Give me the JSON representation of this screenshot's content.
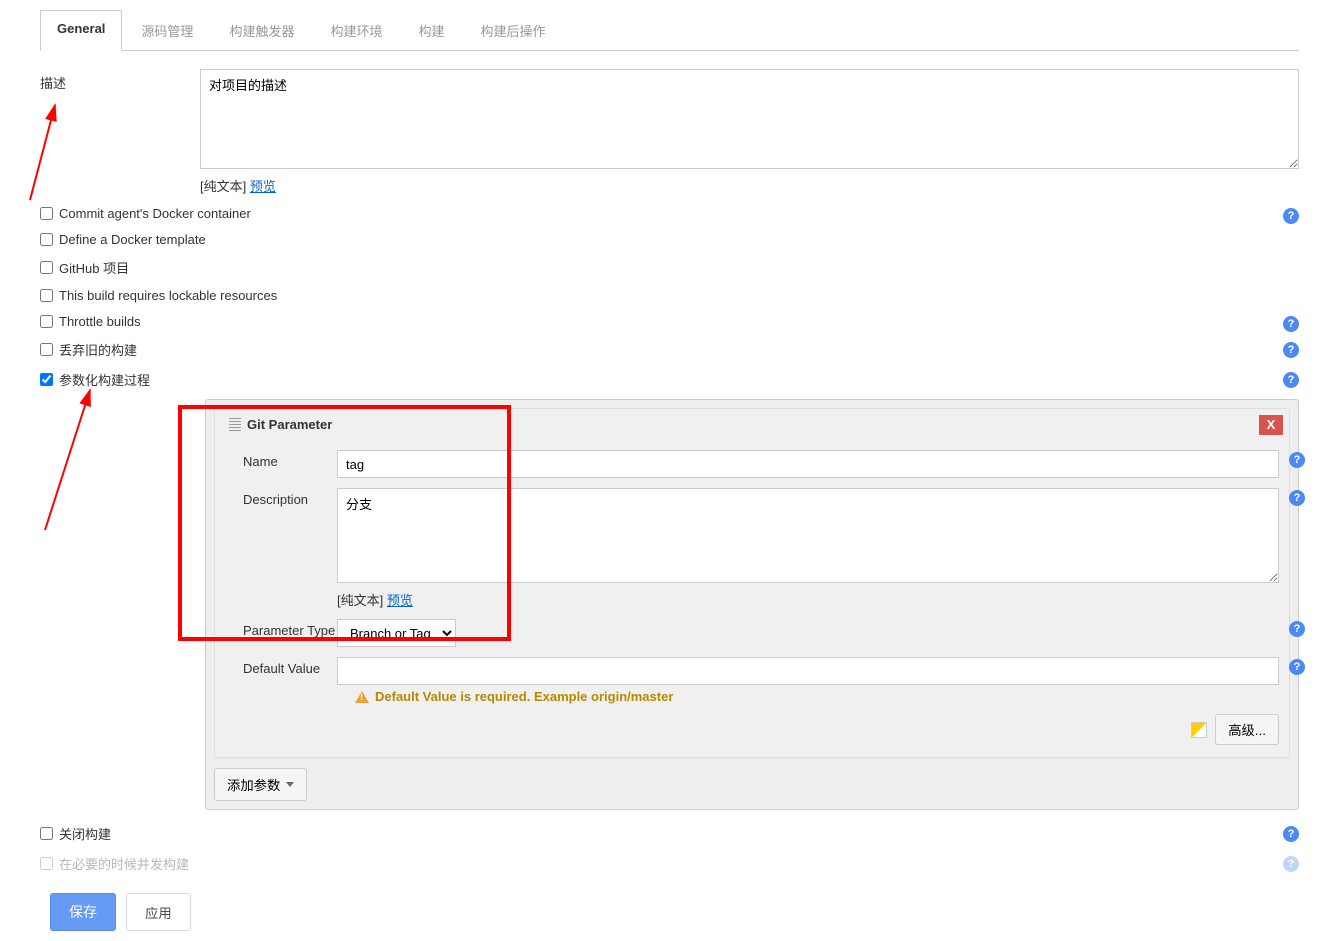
{
  "tabs": {
    "general": "General",
    "source": "源码管理",
    "triggers": "构建触发器",
    "env": "构建环境",
    "build": "构建",
    "post": "构建后操作"
  },
  "description": {
    "label": "描述",
    "value": "对项目的描述",
    "plain_text": "[纯文本]",
    "preview": "预览"
  },
  "checkboxes": {
    "docker_container": "Commit agent's Docker container",
    "docker_template": "Define a Docker template",
    "github_project": "GitHub 项目",
    "lockable": "This build requires lockable resources",
    "throttle": "Throttle builds",
    "discard_old": "丢弃旧的构建",
    "parameterized": "参数化构建过程",
    "disable_build": "关闭构建",
    "concurrent": "在必要的时候并发构建"
  },
  "git_parameter": {
    "title": "Git Parameter",
    "close": "X",
    "name_label": "Name",
    "name_value": "tag",
    "desc_label": "Description",
    "desc_value": "分支",
    "plain_text": "[纯文本]",
    "preview": "预览",
    "type_label": "Parameter Type",
    "type_value": "Branch or Tag",
    "default_label": "Default Value",
    "default_value": "",
    "warning": "Default Value is required. Example origin/master",
    "advanced": "高级..."
  },
  "add_param": "添加参数",
  "buttons": {
    "save": "保存",
    "apply": "应用"
  },
  "help_tooltip": "?"
}
